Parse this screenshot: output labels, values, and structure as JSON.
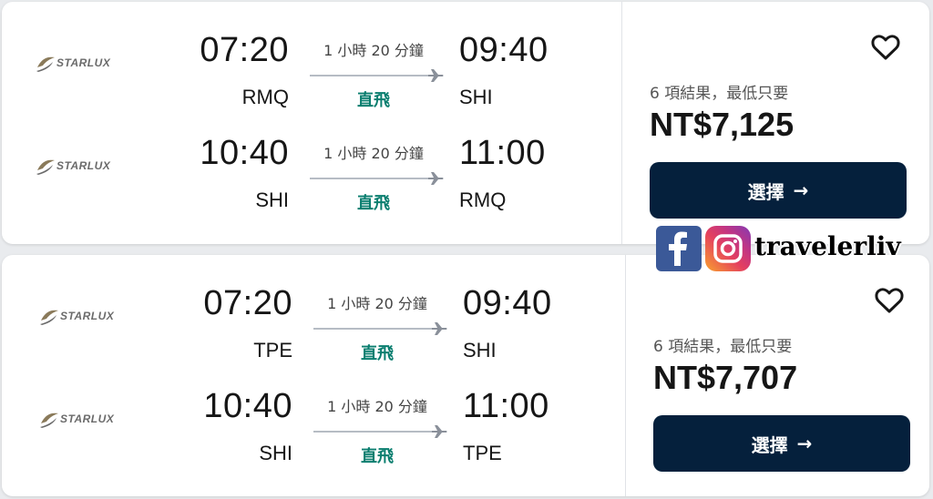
{
  "results": [
    {
      "legs": [
        {
          "airline": "STARLUX",
          "dep_time": "07:20",
          "dep_code": "RMQ",
          "duration": "1 小時 20 分鐘",
          "stops": "直飛",
          "arr_time": "09:40",
          "arr_code": "SHI"
        },
        {
          "airline": "STARLUX",
          "dep_time": "10:40",
          "dep_code": "SHI",
          "duration": "1 小時 20 分鐘",
          "stops": "直飛",
          "arr_time": "11:00",
          "arr_code": "RMQ"
        }
      ],
      "summary": "6 項結果，最低只要",
      "price": "NT$7,125",
      "select_label": "選擇",
      "favorite_icon": "heart-outline-icon"
    },
    {
      "legs": [
        {
          "airline": "STARLUX",
          "dep_time": "07:20",
          "dep_code": "TPE",
          "duration": "1 小時 20 分鐘",
          "stops": "直飛",
          "arr_time": "09:40",
          "arr_code": "SHI"
        },
        {
          "airline": "STARLUX",
          "dep_time": "10:40",
          "dep_code": "SHI",
          "duration": "1 小時 20 分鐘",
          "stops": "直飛",
          "arr_time": "11:00",
          "arr_code": "TPE"
        }
      ],
      "summary": "6 項結果，最低只要",
      "price": "NT$7,707",
      "select_label": "選擇",
      "favorite_icon": "heart-outline-icon"
    }
  ],
  "watermark": {
    "handle": "travelerliv",
    "icons": [
      "facebook-icon",
      "instagram-icon"
    ]
  },
  "colors": {
    "button_bg": "#05203c",
    "direct_text": "#0a7e6f",
    "page_bg": "#e9ebee"
  }
}
